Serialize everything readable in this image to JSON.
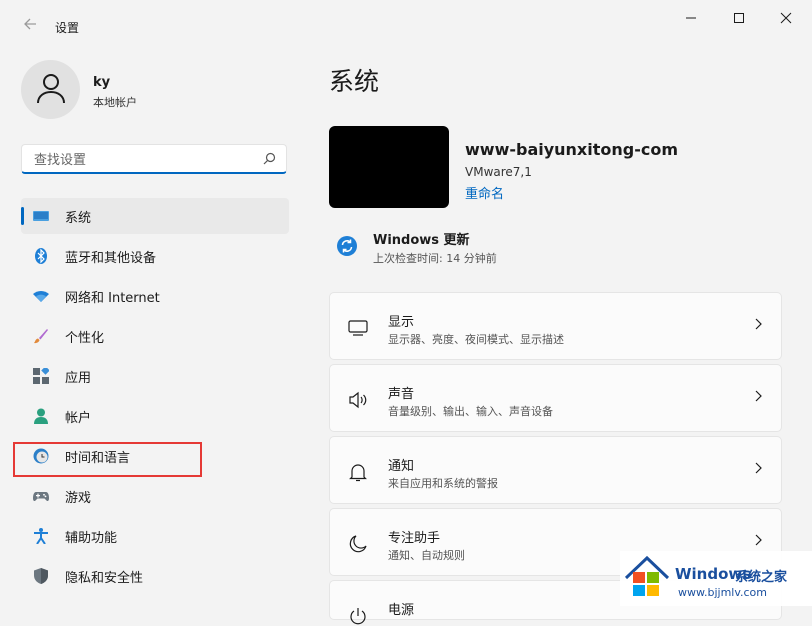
{
  "window": {
    "title": "设置"
  },
  "user": {
    "name": "ky",
    "account_type": "本地帐户"
  },
  "search": {
    "placeholder": "查找设置"
  },
  "nav": {
    "items": [
      {
        "label": "系统",
        "icon": "display-icon",
        "active": true
      },
      {
        "label": "蓝牙和其他设备",
        "icon": "bluetooth-icon"
      },
      {
        "label": "网络和 Internet",
        "icon": "wifi-icon"
      },
      {
        "label": "个性化",
        "icon": "brush-icon"
      },
      {
        "label": "应用",
        "icon": "apps-icon"
      },
      {
        "label": "帐户",
        "icon": "person-icon"
      },
      {
        "label": "时间和语言",
        "icon": "clock-globe-icon",
        "highlighted": true
      },
      {
        "label": "游戏",
        "icon": "gamepad-icon"
      },
      {
        "label": "辅助功能",
        "icon": "accessibility-icon"
      },
      {
        "label": "隐私和安全性",
        "icon": "shield-icon"
      }
    ]
  },
  "main": {
    "title": "系统",
    "device": {
      "name": "www-baiyunxitong-com",
      "model": "VMware7,1",
      "rename_label": "重命名"
    },
    "update": {
      "title": "Windows 更新",
      "subtitle": "上次检查时间: 14 分钟前"
    },
    "cards": [
      {
        "title": "显示",
        "subtitle": "显示器、亮度、夜间模式、显示描述",
        "icon": "monitor-icon"
      },
      {
        "title": "声音",
        "subtitle": "音量级别、输出、输入、声音设备",
        "icon": "speaker-icon"
      },
      {
        "title": "通知",
        "subtitle": "来自应用和系统的警报",
        "icon": "bell-icon"
      },
      {
        "title": "专注助手",
        "subtitle": "通知、自动规则",
        "icon": "moon-icon"
      },
      {
        "title": "电源",
        "subtitle": "",
        "icon": "power-icon"
      }
    ]
  },
  "watermark": {
    "brand": "Windows",
    "brand_suffix": "系统之家",
    "url": "www.bjjmlv.com"
  },
  "colors": {
    "accent": "#0067c0",
    "highlight_box": "#e53935",
    "background": "#f3f3f3"
  }
}
